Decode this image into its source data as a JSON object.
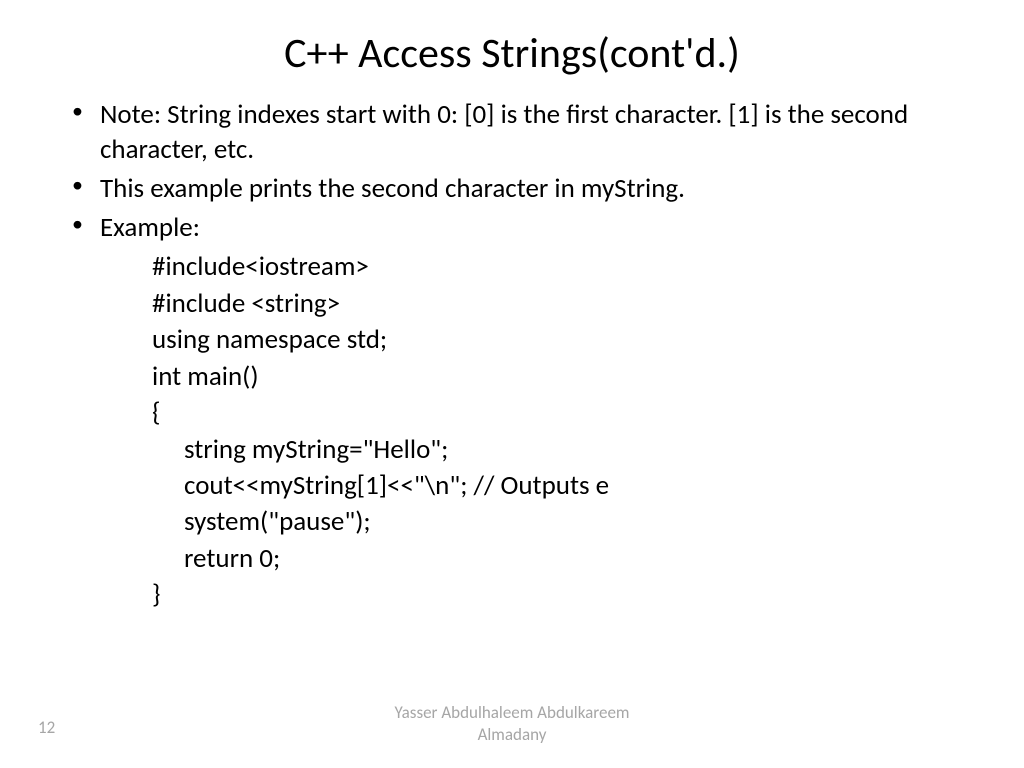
{
  "title": "C++ Access Strings(cont'd.)",
  "bullets": [
    "Note: String indexes start with 0: [0] is the first character. [1] is the second character, etc.",
    "This example prints the second character in myString.",
    "Example:"
  ],
  "code": {
    "line1": "#include<iostream>",
    "line2": "#include <string>",
    "line3": "using namespace std;",
    "line4": "int main()",
    "line5": "{",
    "line6": "string myString=\"Hello\";",
    "line7": "cout<<myString[1]<<\"\\n\"; // Outputs e",
    "line8": "system(\"pause\");",
    "line9": "return 0;",
    "line10": "}"
  },
  "footer": {
    "author_line1": "Yasser Abdulhaleem Abdulkareem",
    "author_line2": "Almadany",
    "page": "12"
  }
}
